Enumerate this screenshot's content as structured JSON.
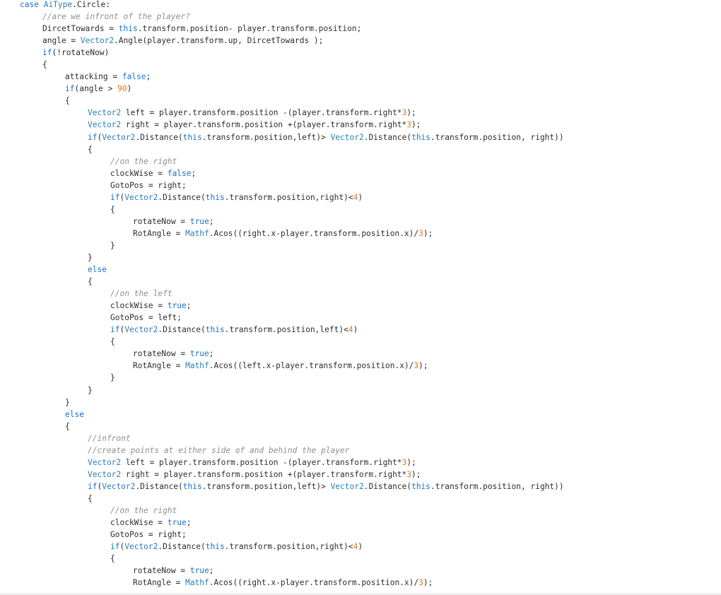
{
  "editor": {
    "lines": [
      {
        "indent": 0,
        "tokens": [
          {
            "k": "keyword",
            "t": "case"
          },
          {
            "k": "plain",
            "t": " "
          },
          {
            "k": "type",
            "t": "AiType"
          },
          {
            "k": "plain",
            "t": ".Circle:"
          }
        ]
      },
      {
        "indent": 1,
        "tokens": [
          {
            "k": "comment",
            "t": "//are we infront of the player?"
          }
        ]
      },
      {
        "indent": 1,
        "tokens": [
          {
            "k": "plain",
            "t": "DircetTowards = "
          },
          {
            "k": "keyword",
            "t": "this"
          },
          {
            "k": "plain",
            "t": ".transform.position- player.transform.position;"
          }
        ]
      },
      {
        "indent": 1,
        "tokens": [
          {
            "k": "plain",
            "t": "angle = "
          },
          {
            "k": "type",
            "t": "Vector2"
          },
          {
            "k": "plain",
            "t": ".Angle(player.transform.up, DircetTowards );"
          }
        ]
      },
      {
        "indent": 1,
        "tokens": [
          {
            "k": "keyword",
            "t": "if"
          },
          {
            "k": "plain",
            "t": "(!rotateNow)"
          }
        ]
      },
      {
        "indent": 1,
        "tokens": [
          {
            "k": "plain",
            "t": "{"
          }
        ]
      },
      {
        "indent": 2,
        "tokens": [
          {
            "k": "plain",
            "t": "attacking = "
          },
          {
            "k": "keyword",
            "t": "false"
          },
          {
            "k": "plain",
            "t": ";"
          }
        ]
      },
      {
        "indent": 2,
        "tokens": [
          {
            "k": "keyword",
            "t": "if"
          },
          {
            "k": "plain",
            "t": "(angle > "
          },
          {
            "k": "number",
            "t": "90"
          },
          {
            "k": "plain",
            "t": ")"
          }
        ]
      },
      {
        "indent": 2,
        "tokens": [
          {
            "k": "plain",
            "t": "{"
          }
        ]
      },
      {
        "indent": 3,
        "tokens": [
          {
            "k": "type",
            "t": "Vector2"
          },
          {
            "k": "plain",
            "t": " left = player.transform.position -(player.transform.right*"
          },
          {
            "k": "number",
            "t": "3"
          },
          {
            "k": "plain",
            "t": ");"
          }
        ]
      },
      {
        "indent": 3,
        "tokens": [
          {
            "k": "type",
            "t": "Vector2"
          },
          {
            "k": "plain",
            "t": " right = player.transform.position +(player.transform.right*"
          },
          {
            "k": "number",
            "t": "3"
          },
          {
            "k": "plain",
            "t": ");"
          }
        ]
      },
      {
        "indent": 3,
        "tokens": [
          {
            "k": "keyword",
            "t": "if"
          },
          {
            "k": "plain",
            "t": "("
          },
          {
            "k": "type",
            "t": "Vector2"
          },
          {
            "k": "plain",
            "t": ".Distance("
          },
          {
            "k": "keyword",
            "t": "this"
          },
          {
            "k": "plain",
            "t": ".transform.position,left)> "
          },
          {
            "k": "type",
            "t": "Vector2"
          },
          {
            "k": "plain",
            "t": ".Distance("
          },
          {
            "k": "keyword",
            "t": "this"
          },
          {
            "k": "plain",
            "t": ".transform.position, right))"
          }
        ]
      },
      {
        "indent": 3,
        "tokens": [
          {
            "k": "plain",
            "t": "{"
          }
        ]
      },
      {
        "indent": 4,
        "tokens": [
          {
            "k": "comment",
            "t": "//on the right"
          }
        ]
      },
      {
        "indent": 4,
        "tokens": [
          {
            "k": "plain",
            "t": "clockWise = "
          },
          {
            "k": "keyword",
            "t": "false"
          },
          {
            "k": "plain",
            "t": ";"
          }
        ]
      },
      {
        "indent": 4,
        "tokens": [
          {
            "k": "plain",
            "t": "GotoPos = right;"
          }
        ]
      },
      {
        "indent": 4,
        "tokens": [
          {
            "k": "keyword",
            "t": "if"
          },
          {
            "k": "plain",
            "t": "("
          },
          {
            "k": "type",
            "t": "Vector2"
          },
          {
            "k": "plain",
            "t": ".Distance("
          },
          {
            "k": "keyword",
            "t": "this"
          },
          {
            "k": "plain",
            "t": ".transform.position,right)<"
          },
          {
            "k": "number",
            "t": "4"
          },
          {
            "k": "plain",
            "t": ")"
          }
        ]
      },
      {
        "indent": 4,
        "tokens": [
          {
            "k": "plain",
            "t": "{"
          }
        ]
      },
      {
        "indent": 5,
        "tokens": [
          {
            "k": "plain",
            "t": "rotateNow = "
          },
          {
            "k": "keyword",
            "t": "true"
          },
          {
            "k": "plain",
            "t": ";"
          }
        ]
      },
      {
        "indent": 5,
        "tokens": [
          {
            "k": "plain",
            "t": "RotAngle = "
          },
          {
            "k": "type",
            "t": "Mathf"
          },
          {
            "k": "plain",
            "t": ".Acos((right.x-player.transform.position.x)/"
          },
          {
            "k": "number",
            "t": "3"
          },
          {
            "k": "plain",
            "t": ");"
          }
        ]
      },
      {
        "indent": 4,
        "tokens": [
          {
            "k": "plain",
            "t": "}"
          }
        ]
      },
      {
        "indent": 3,
        "tokens": [
          {
            "k": "plain",
            "t": "}"
          }
        ]
      },
      {
        "indent": 3,
        "tokens": [
          {
            "k": "keyword",
            "t": "else"
          }
        ]
      },
      {
        "indent": 3,
        "tokens": [
          {
            "k": "plain",
            "t": "{"
          }
        ]
      },
      {
        "indent": 4,
        "tokens": [
          {
            "k": "comment",
            "t": "//on the left"
          }
        ]
      },
      {
        "indent": 4,
        "tokens": [
          {
            "k": "plain",
            "t": "clockWise = "
          },
          {
            "k": "keyword",
            "t": "true"
          },
          {
            "k": "plain",
            "t": ";"
          }
        ]
      },
      {
        "indent": 4,
        "tokens": [
          {
            "k": "plain",
            "t": "GotoPos = left;"
          }
        ]
      },
      {
        "indent": 4,
        "tokens": [
          {
            "k": "keyword",
            "t": "if"
          },
          {
            "k": "plain",
            "t": "("
          },
          {
            "k": "type",
            "t": "Vector2"
          },
          {
            "k": "plain",
            "t": ".Distance("
          },
          {
            "k": "keyword",
            "t": "this"
          },
          {
            "k": "plain",
            "t": ".transform.position,left)<"
          },
          {
            "k": "number",
            "t": "4"
          },
          {
            "k": "plain",
            "t": ")"
          }
        ]
      },
      {
        "indent": 4,
        "tokens": [
          {
            "k": "plain",
            "t": "{"
          }
        ]
      },
      {
        "indent": 5,
        "tokens": [
          {
            "k": "plain",
            "t": "rotateNow = "
          },
          {
            "k": "keyword",
            "t": "true"
          },
          {
            "k": "plain",
            "t": ";"
          }
        ]
      },
      {
        "indent": 5,
        "tokens": [
          {
            "k": "plain",
            "t": "RotAngle = "
          },
          {
            "k": "type",
            "t": "Mathf"
          },
          {
            "k": "plain",
            "t": ".Acos((left.x-player.transform.position.x)/"
          },
          {
            "k": "number",
            "t": "3"
          },
          {
            "k": "plain",
            "t": ");"
          }
        ]
      },
      {
        "indent": 4,
        "tokens": [
          {
            "k": "plain",
            "t": "}"
          }
        ]
      },
      {
        "indent": 3,
        "tokens": [
          {
            "k": "plain",
            "t": "}"
          }
        ]
      },
      {
        "indent": 2,
        "tokens": [
          {
            "k": "plain",
            "t": "}"
          }
        ]
      },
      {
        "indent": 2,
        "tokens": [
          {
            "k": "keyword",
            "t": "else"
          }
        ]
      },
      {
        "indent": 2,
        "tokens": [
          {
            "k": "plain",
            "t": "{"
          }
        ]
      },
      {
        "indent": 3,
        "tokens": [
          {
            "k": "comment",
            "t": "//infront"
          }
        ]
      },
      {
        "indent": 3,
        "tokens": [
          {
            "k": "comment",
            "t": "//create points at either side of and behind the player"
          }
        ]
      },
      {
        "indent": 3,
        "tokens": [
          {
            "k": "type",
            "t": "Vector2"
          },
          {
            "k": "plain",
            "t": " left = player.transform.position -(player.transform.right*"
          },
          {
            "k": "number",
            "t": "3"
          },
          {
            "k": "plain",
            "t": ");"
          }
        ]
      },
      {
        "indent": 3,
        "tokens": [
          {
            "k": "type",
            "t": "Vector2"
          },
          {
            "k": "plain",
            "t": " right = player.transform.position +(player.transform.right*"
          },
          {
            "k": "number",
            "t": "3"
          },
          {
            "k": "plain",
            "t": ");"
          }
        ]
      },
      {
        "indent": 3,
        "tokens": [
          {
            "k": "keyword",
            "t": "if"
          },
          {
            "k": "plain",
            "t": "("
          },
          {
            "k": "type",
            "t": "Vector2"
          },
          {
            "k": "plain",
            "t": ".Distance("
          },
          {
            "k": "keyword",
            "t": "this"
          },
          {
            "k": "plain",
            "t": ".transform.position,left)> "
          },
          {
            "k": "type",
            "t": "Vector2"
          },
          {
            "k": "plain",
            "t": ".Distance("
          },
          {
            "k": "keyword",
            "t": "this"
          },
          {
            "k": "plain",
            "t": ".transform.position, right))"
          }
        ]
      },
      {
        "indent": 3,
        "tokens": [
          {
            "k": "plain",
            "t": "{"
          }
        ]
      },
      {
        "indent": 4,
        "tokens": [
          {
            "k": "comment",
            "t": "//on the right"
          }
        ]
      },
      {
        "indent": 4,
        "tokens": [
          {
            "k": "plain",
            "t": "clockWise = "
          },
          {
            "k": "keyword",
            "t": "true"
          },
          {
            "k": "plain",
            "t": ";"
          }
        ]
      },
      {
        "indent": 4,
        "tokens": [
          {
            "k": "plain",
            "t": "GotoPos = right;"
          }
        ]
      },
      {
        "indent": 4,
        "tokens": [
          {
            "k": "keyword",
            "t": "if"
          },
          {
            "k": "plain",
            "t": "("
          },
          {
            "k": "type",
            "t": "Vector2"
          },
          {
            "k": "plain",
            "t": ".Distance("
          },
          {
            "k": "keyword",
            "t": "this"
          },
          {
            "k": "plain",
            "t": ".transform.position,right)<"
          },
          {
            "k": "number",
            "t": "4"
          },
          {
            "k": "plain",
            "t": ")"
          }
        ]
      },
      {
        "indent": 4,
        "tokens": [
          {
            "k": "plain",
            "t": "{"
          }
        ]
      },
      {
        "indent": 5,
        "tokens": [
          {
            "k": "plain",
            "t": "rotateNow = "
          },
          {
            "k": "keyword",
            "t": "true"
          },
          {
            "k": "plain",
            "t": ";"
          }
        ]
      },
      {
        "indent": 5,
        "tokens": [
          {
            "k": "plain",
            "t": "RotAngle = "
          },
          {
            "k": "type",
            "t": "Mathf"
          },
          {
            "k": "plain",
            "t": ".Acos((right.x-player.transform.position.x)/"
          },
          {
            "k": "number",
            "t": "3"
          },
          {
            "k": "plain",
            "t": ");"
          }
        ]
      }
    ]
  },
  "colors": {
    "background": "#ffffff",
    "plain": "#2d2d2d",
    "keyword": "#1e6ec8",
    "type": "#2a7fb8",
    "comment": "#8f8f8f",
    "number": "#e07a1a"
  }
}
